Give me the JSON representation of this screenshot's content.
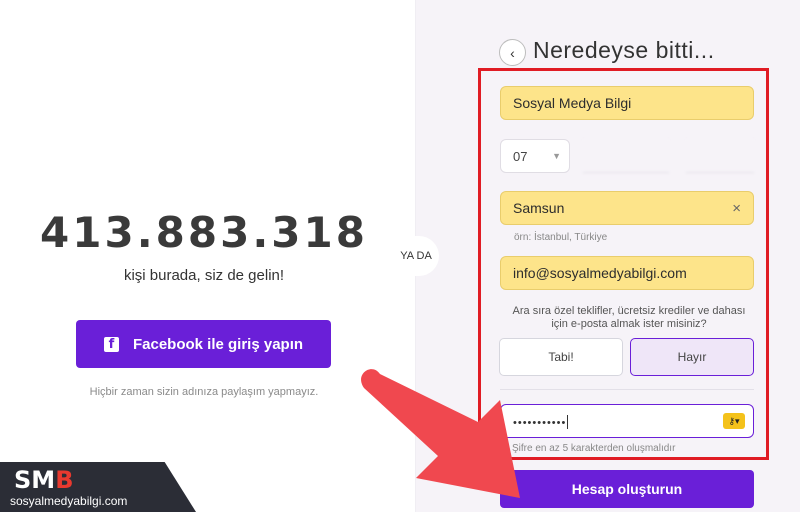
{
  "left": {
    "count": "413.883.318",
    "tagline": "kişi burada, siz de gelin!",
    "facebook_button": "Facebook ile giriş yapın",
    "facebook_icon": "facebook-icon",
    "privacy_note": "Hiçbir zaman sizin adınıza paylaşım yapmayız."
  },
  "or_label": "YA DA",
  "form": {
    "back_icon": "chevron-left-icon",
    "back_glyph": "‹",
    "title": "Neredeyse bitti...",
    "name_value": "Sosyal Medya Bilgi",
    "birth_day": "07",
    "birth_month": "",
    "birth_year": "",
    "city_value": "Samsun",
    "city_clear": "×",
    "city_hint": "örn: İstanbul, Türkiye",
    "email_value": "info@sosyalmedyabilgi.com",
    "optin_question": "Ara sıra özel teklifler, ücretsiz krediler ve dahası için e-posta almak ister misiniz?",
    "optin_yes": "Tabi!",
    "optin_no": "Hayır",
    "optin_selected": "Hayır",
    "password_value": "•••••••••••",
    "password_hint": "Şifre en az 5 karakterden oluşmalıdır",
    "create_button": "Hesap oluşturun"
  },
  "watermark": {
    "logo_s": "S",
    "logo_m": "M",
    "logo_b": "B",
    "site": "sosyalmedyabilgi.com"
  },
  "colors": {
    "accent_purple": "#6a1fd8",
    "field_yellow": "#fde48a",
    "highlight_red": "#e01b24",
    "arrow_red": "#f0484f"
  }
}
